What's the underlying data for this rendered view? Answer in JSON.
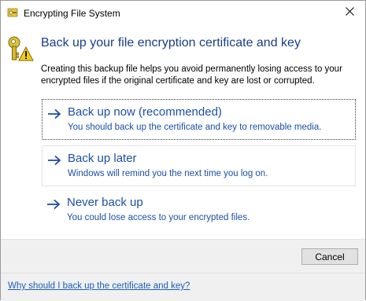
{
  "window": {
    "title": "Encrypting File System",
    "close_icon": "close-icon",
    "title_icon": "efs-key-icon"
  },
  "main": {
    "heading": "Back up your file encryption certificate and key",
    "description": "Creating this backup file helps you avoid permanently losing access to your encrypted files if the original certificate and key are lost or corrupted.",
    "header_icon": "key-warning-icon"
  },
  "options": [
    {
      "title": "Back up now (recommended)",
      "subtitle": "You should back up the certificate and key to removable media.",
      "icon": "arrow-right-icon",
      "focused": true
    },
    {
      "title": "Back up later",
      "subtitle": "Windows will remind you the next time you log on.",
      "icon": "arrow-right-icon",
      "focused": false
    },
    {
      "title": "Never back up",
      "subtitle": "You could lose access to your encrypted files.",
      "icon": "arrow-right-icon",
      "focused": false
    }
  ],
  "buttons": {
    "cancel_label": "Cancel"
  },
  "footer": {
    "help_link": "Why should I back up the certificate and key?"
  },
  "colors": {
    "heading": "#1a3e8a",
    "link": "#1c4fa8",
    "footer_bg": "#f0f0f0"
  }
}
